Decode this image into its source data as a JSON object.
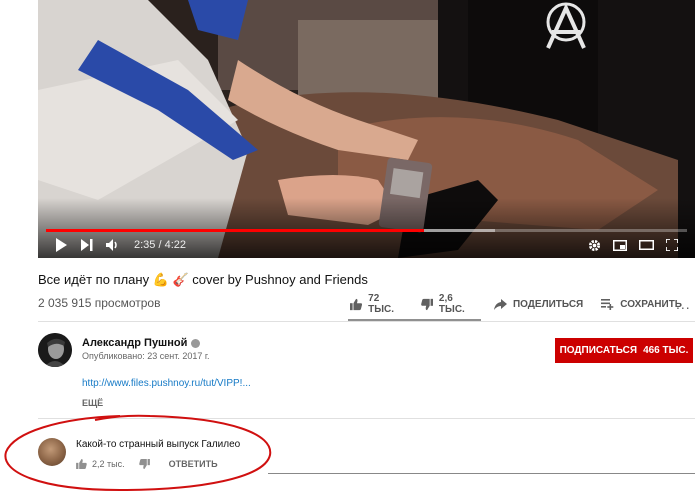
{
  "player": {
    "time_current": "2:35",
    "time_separator": "/",
    "time_total": "4:22",
    "progress": 0.59
  },
  "video": {
    "title": "Все идёт по плану 💪 🎸 cover by Pushnoy and Friends",
    "views": "2 035 915 просмотров",
    "likes": "72 ТЫС.",
    "dislikes": "2,6 ТЫС.",
    "share_label": "ПОДЕЛИТЬСЯ",
    "save_label": "СОХРАНИТЬ",
    "more_label": "..."
  },
  "channel": {
    "name": "Александр Пушной",
    "published": "Опубликовано: 23 сент. 2017 г.",
    "subscribe_label": "ПОДПИСАТЬСЯ",
    "subscriber_count": "466 ТЫС.",
    "description_link": "http://www.files.pushnoy.ru/tut/VIPP!...",
    "show_more": "ЕЩЁ"
  },
  "comment": {
    "text": "Какой-то странный выпуск Галилео",
    "likes": "2,2 тыс.",
    "reply_label": "ОТВЕТИТЬ"
  },
  "colors": {
    "accent": "#cc0000",
    "link": "#167ac6",
    "annotation": "#d01010"
  },
  "icons": [
    "play-icon",
    "next-icon",
    "volume-icon",
    "settings-icon",
    "miniplayer-icon",
    "theater-icon",
    "fullscreen-icon",
    "thumb-up-icon",
    "thumb-down-icon",
    "share-icon",
    "save-icon",
    "more-icon",
    "verified-icon"
  ]
}
